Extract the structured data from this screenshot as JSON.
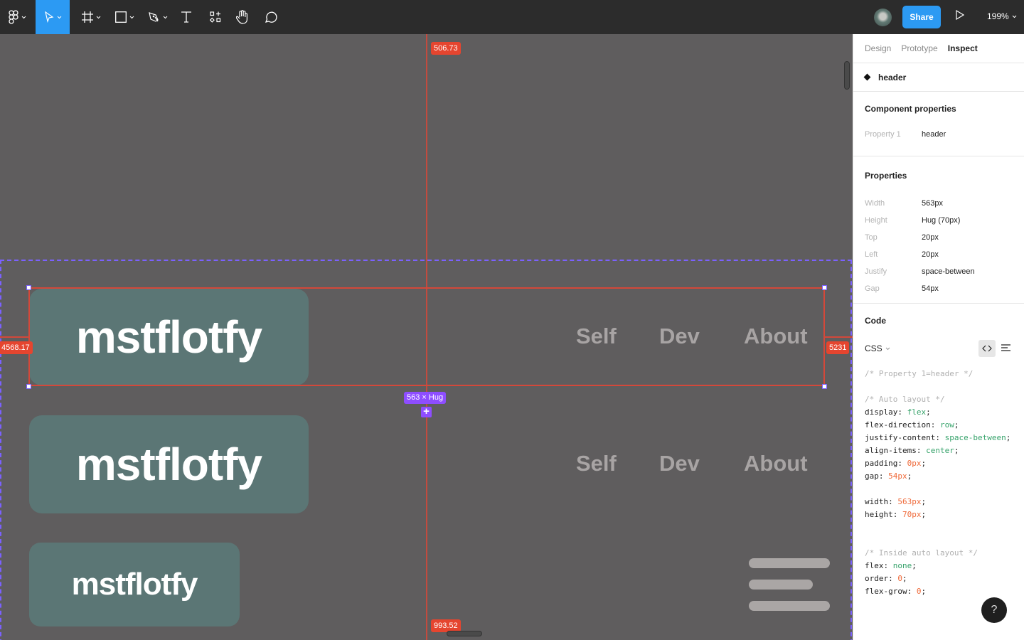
{
  "toolbar": {
    "tools": [
      {
        "name": "main-menu-icon"
      },
      {
        "name": "move-tool-icon",
        "active": true
      },
      {
        "name": "frame-tool-icon"
      },
      {
        "name": "shape-tool-icon"
      },
      {
        "name": "pen-tool-icon"
      },
      {
        "name": "text-tool-icon"
      },
      {
        "name": "resources-icon"
      },
      {
        "name": "hand-tool-icon"
      },
      {
        "name": "comment-tool-icon"
      }
    ],
    "share_label": "Share",
    "zoom_level": "199%",
    "accent_color": "#2c9af3"
  },
  "canvas": {
    "measurements": {
      "top": "506.73",
      "bottom": "993.52",
      "left": "4568.17",
      "right": "5231",
      "size": "563 × Hug"
    },
    "headers": [
      {
        "logo": "mstflotfy",
        "nav": [
          "Self",
          "Dev",
          "About"
        ],
        "variant": "large"
      },
      {
        "logo": "mstflotfy",
        "nav": [
          "Self",
          "Dev",
          "About"
        ],
        "variant": "large"
      },
      {
        "logo": "mstflotfy",
        "variant": "small-menu"
      }
    ],
    "colors": {
      "logo_bg": "#5b7675",
      "nav_text": "#a8a4a4",
      "measure": "#e5452f",
      "selection": "#7b61ff"
    }
  },
  "panel": {
    "tabs": [
      {
        "label": "Design",
        "active": false
      },
      {
        "label": "Prototype",
        "active": false
      },
      {
        "label": "Inspect",
        "active": true
      }
    ],
    "layer_name": "header",
    "component_properties": {
      "title": "Component properties",
      "rows": [
        {
          "key": "Property 1",
          "value": "header"
        }
      ]
    },
    "properties": {
      "title": "Properties",
      "rows": [
        {
          "key": "Width",
          "value": "563px"
        },
        {
          "key": "Height",
          "value": "Hug (70px)"
        },
        {
          "key": "Top",
          "value": "20px"
        },
        {
          "key": "Left",
          "value": "20px"
        },
        {
          "key": "Justify",
          "value": "space-between"
        },
        {
          "key": "Gap",
          "value": "54px"
        }
      ]
    },
    "code": {
      "title": "Code",
      "language": "CSS",
      "lines": [
        [
          {
            "t": "/* Property 1=header */",
            "c": "cm"
          }
        ],
        [],
        [
          {
            "t": "/* Auto layout */",
            "c": "cm"
          }
        ],
        [
          {
            "t": "display: "
          },
          {
            "t": "flex",
            "c": "kw"
          },
          {
            "t": ";"
          }
        ],
        [
          {
            "t": "flex-direction: "
          },
          {
            "t": "row",
            "c": "kw"
          },
          {
            "t": ";"
          }
        ],
        [
          {
            "t": "justify-content: "
          },
          {
            "t": "space-between",
            "c": "kw"
          },
          {
            "t": ";"
          }
        ],
        [
          {
            "t": "align-items: "
          },
          {
            "t": "center",
            "c": "kw"
          },
          {
            "t": ";"
          }
        ],
        [
          {
            "t": "padding: "
          },
          {
            "t": "0px",
            "c": "num"
          },
          {
            "t": ";"
          }
        ],
        [
          {
            "t": "gap: "
          },
          {
            "t": "54px",
            "c": "num"
          },
          {
            "t": ";"
          }
        ],
        [],
        [
          {
            "t": "width: "
          },
          {
            "t": "563px",
            "c": "num"
          },
          {
            "t": ";"
          }
        ],
        [
          {
            "t": "height: "
          },
          {
            "t": "70px",
            "c": "num"
          },
          {
            "t": ";"
          }
        ],
        [],
        [],
        [
          {
            "t": "/* Inside auto layout */",
            "c": "cm"
          }
        ],
        [
          {
            "t": "flex: "
          },
          {
            "t": "none",
            "c": "kw"
          },
          {
            "t": ";"
          }
        ],
        [
          {
            "t": "order: "
          },
          {
            "t": "0",
            "c": "num"
          },
          {
            "t": ";"
          }
        ],
        [
          {
            "t": "flex-grow: "
          },
          {
            "t": "0",
            "c": "num"
          },
          {
            "t": ";"
          }
        ]
      ]
    },
    "help_label": "?"
  }
}
